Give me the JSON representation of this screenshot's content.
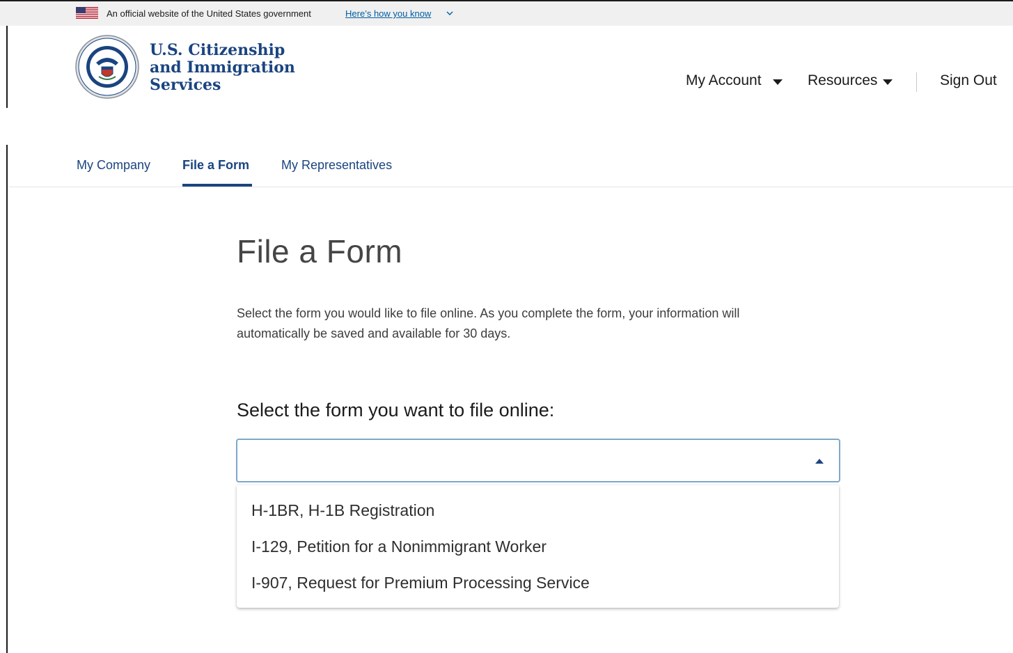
{
  "gov_banner": {
    "text": "An official website of the United States government",
    "link": "Here’s how you know"
  },
  "header": {
    "agency_line1": "U.S. Citizenship",
    "agency_line2": "and Immigration",
    "agency_line3": "Services",
    "nav": {
      "my_account": "My Account",
      "resources": "Resources",
      "sign_out": "Sign Out"
    }
  },
  "tabs": [
    {
      "label": "My Company"
    },
    {
      "label": "File a Form"
    },
    {
      "label": "My Representatives"
    }
  ],
  "main": {
    "title": "File a Form",
    "intro": "Select the form you would like to file online. As you complete the form, your information will automatically be saved and available for 30 days.",
    "select_label": "Select the form you want to file online:",
    "combo_value": "",
    "options": [
      "H-1BR, H-1B Registration",
      "I-129, Petition for a Nonimmigrant Worker",
      "I-907, Request for Premium Processing Service"
    ]
  },
  "colors": {
    "brand_navy": "#1a4480",
    "link_blue": "#005ea2",
    "focus_border": "#7ea8c9"
  }
}
